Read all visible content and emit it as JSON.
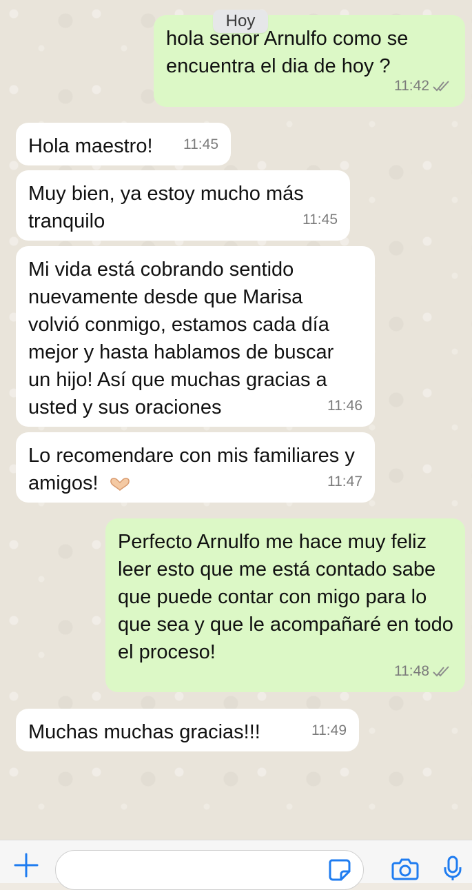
{
  "date_label": "Hoy",
  "messages": [
    {
      "dir": "out",
      "text": "hola señor Arnulfo como se encuentra el dia de hoy ?",
      "time": "11:42",
      "status": "read"
    },
    {
      "dir": "in",
      "text": "Hola maestro!",
      "time": "11:45"
    },
    {
      "dir": "in",
      "text": "Muy bien, ya estoy mucho más tranquilo",
      "time": "11:45"
    },
    {
      "dir": "in",
      "text": "Mi vida está cobrando sentido nuevamente desde que Marisa volvió conmigo, estamos cada día mejor y hasta hablamos de buscar un hijo! Así que muchas gracias a usted y sus oraciones",
      "time": "11:46"
    },
    {
      "dir": "in",
      "text": "Lo recomendare con mis familiares y amigos!",
      "emoji": "heart-hands-icon",
      "time": "11:47"
    },
    {
      "dir": "out",
      "text": "Perfecto Arnulfo me hace muy feliz leer esto que me está contado sabe que puede contar con migo para lo que sea y que le acompañaré en todo el proceso!",
      "time": "11:48",
      "status": "read"
    },
    {
      "dir": "in",
      "text": "Muchas muchas gracias!!!",
      "time": "11:49"
    }
  ],
  "composer": {
    "input_value": "",
    "icons": [
      "plus-icon",
      "sticker-icon",
      "camera-icon",
      "mic-icon"
    ]
  },
  "colors": {
    "incoming_bubble": "#ffffff",
    "outgoing_bubble": "#dcf8c6",
    "chat_background": "#e9e4da",
    "read_ticks": "#8c8c8c"
  }
}
